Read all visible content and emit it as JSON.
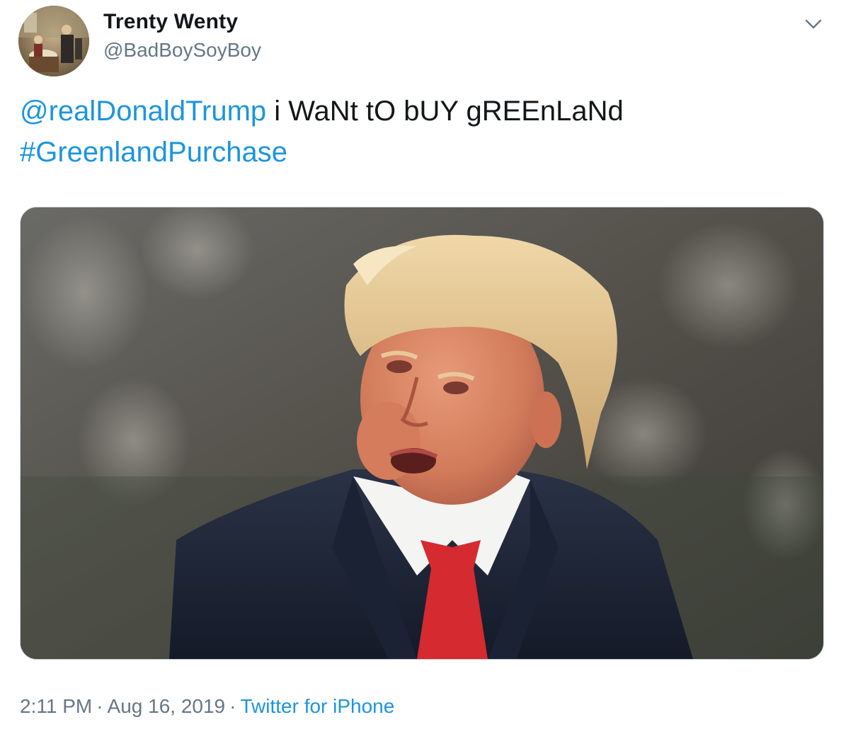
{
  "user": {
    "display_name": "Trenty Wenty",
    "handle": "@BadBoySoyBoy"
  },
  "tweet": {
    "mention": "@realDonaldTrump",
    "body": " i WaNt tO bUY gREEnLaNd",
    "hashtag": "#GreenlandPurchase"
  },
  "meta": {
    "time": "2:11 PM",
    "separator": "·",
    "date": "Aug 16, 2019",
    "source": "Twitter for iPhone"
  },
  "icons": {
    "menu": "chevron-down-icon"
  },
  "colors": {
    "link": "#1b95e0",
    "secondary_text": "#657786",
    "primary_text": "#14171a",
    "border": "#ccd6dd"
  }
}
